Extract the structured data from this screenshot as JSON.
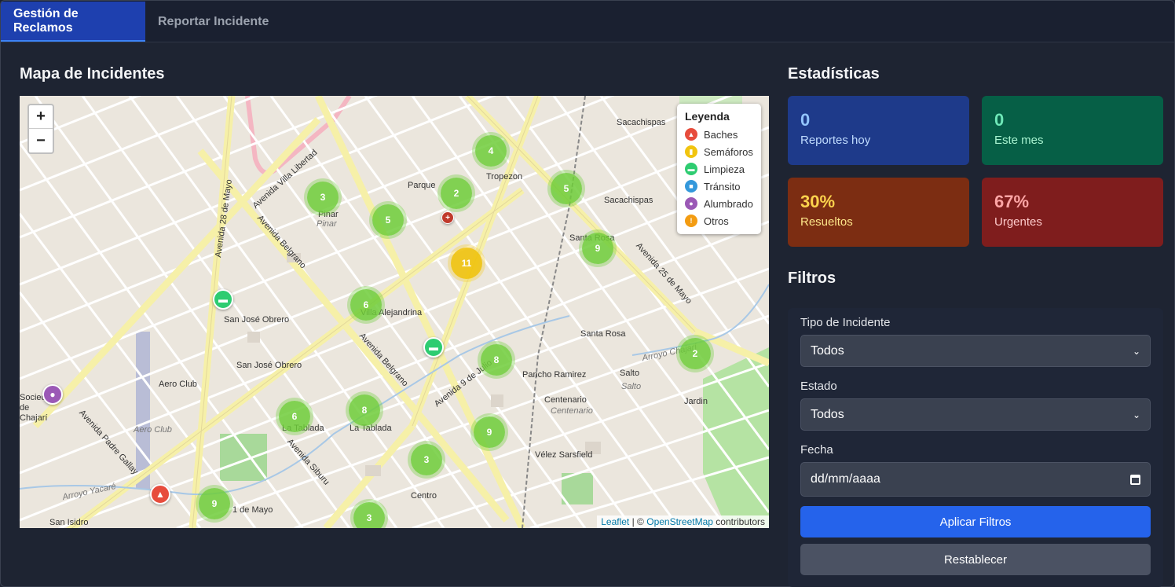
{
  "tabs": [
    {
      "label": "Gestión de Reclamos",
      "active": true
    },
    {
      "label": "Reportar Incidente",
      "active": false
    }
  ],
  "map_section": {
    "title": "Mapa de Incidentes",
    "zoom_in": "+",
    "zoom_out": "−",
    "legend": {
      "title": "Leyenda",
      "items": [
        {
          "label": "Baches",
          "color": "#e74c3c",
          "icon": "pothole-icon"
        },
        {
          "label": "Semáforos",
          "color": "#f1c40f",
          "icon": "traffic-light-icon"
        },
        {
          "label": "Limpieza",
          "color": "#2ecc71",
          "icon": "trash-icon"
        },
        {
          "label": "Tránsito",
          "color": "#3498db",
          "icon": "car-icon"
        },
        {
          "label": "Alumbrado",
          "color": "#9b59b6",
          "icon": "bulb-icon"
        },
        {
          "label": "Otros",
          "color": "#f39c12",
          "icon": "warning-icon"
        }
      ]
    },
    "attribution": {
      "leaflet": "Leaflet",
      "sep": "| ©",
      "osm": "OpenStreetMap",
      "suffix": "contributors"
    },
    "clusters": [
      {
        "count": "4"
      },
      {
        "count": "2"
      },
      {
        "count": "5"
      },
      {
        "count": "3"
      },
      {
        "count": "5"
      },
      {
        "count": "9"
      },
      {
        "count": "11"
      },
      {
        "count": "6"
      },
      {
        "count": "2"
      },
      {
        "count": "8"
      },
      {
        "count": "6"
      },
      {
        "count": "8"
      },
      {
        "count": "9"
      },
      {
        "count": "3"
      },
      {
        "count": "9"
      },
      {
        "count": "3"
      }
    ],
    "place_labels": [
      "Parque",
      "Tropezon",
      "Pinar",
      "Pinar",
      "Sacachispas",
      "Sacachispas",
      "Santa Rosa",
      "Santa Rosa",
      "San José Obrero",
      "San José Obrero",
      "Villa Alejandrina",
      "Pancho Ramirez",
      "Salto",
      "Salto",
      "Aero Club",
      "Aero Club",
      "Centenario",
      "Centenario",
      "Jardin",
      "Vélez Sarsfield",
      "La Tablada",
      "La Tablada",
      "Centro",
      "San Isidro",
      "1 de Mayo",
      "Avenida Belgrano",
      "Avenida Belgrano",
      "Avenida 9 de Julio",
      "Avenida 28 de Mayo",
      "Avenida Siburu",
      "Avenida Padre Gallay",
      "Avenida 25 de Mayo",
      "Avenida Villa Libertad",
      "Arroyo Yacaré",
      "Arroyo Chajarí",
      "Sociedad de Chajarí"
    ]
  },
  "stats": {
    "title": "Estadísticas",
    "cards": [
      {
        "value": "0",
        "label": "Reportes hoy",
        "bg": "#1e3a8a",
        "val_color": "#93c5fd"
      },
      {
        "value": "0",
        "label": "Este mes",
        "bg": "#065f46",
        "val_color": "#6ee7b7"
      },
      {
        "value": "30%",
        "label": "Resueltos",
        "bg": "#7c2d12",
        "val_color": "#fcd34d"
      },
      {
        "value": "67%",
        "label": "Urgentes",
        "bg": "#7f1d1d",
        "val_color": "#fca5a5"
      }
    ]
  },
  "filters": {
    "title": "Filtros",
    "type_label": "Tipo de Incidente",
    "type_value": "Todos",
    "state_label": "Estado",
    "state_value": "Todos",
    "date_label": "Fecha",
    "date_placeholder": "dd/mm/aaaa",
    "apply_label": "Aplicar Filtros",
    "reset_label": "Restablecer"
  }
}
